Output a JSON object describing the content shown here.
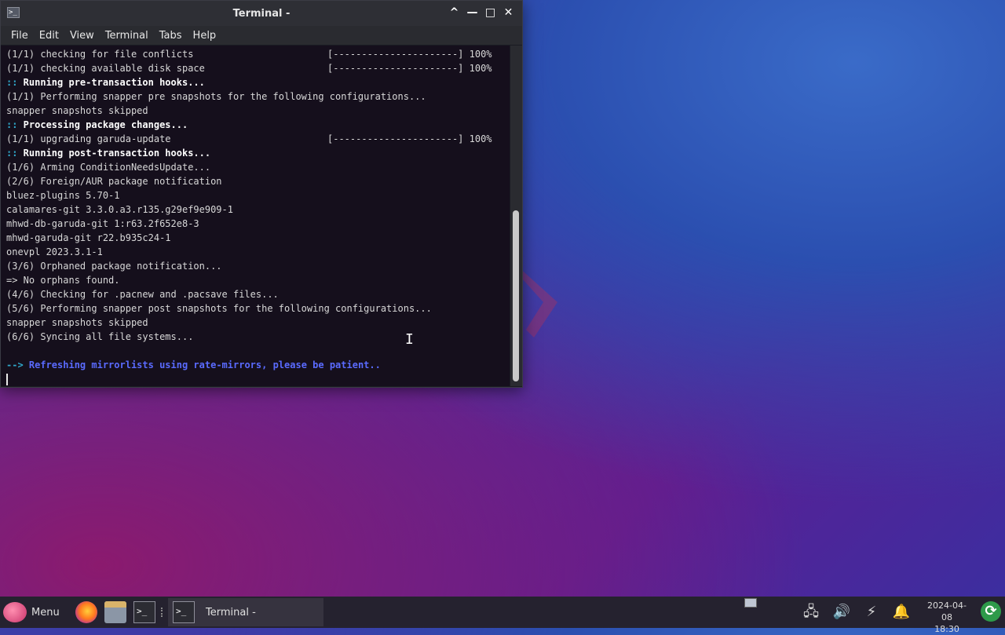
{
  "window": {
    "title": "Terminal -",
    "controls": {
      "shade": "^",
      "minimize": "—",
      "maximize": "□",
      "close": "✕"
    }
  },
  "menubar": [
    "File",
    "Edit",
    "View",
    "Terminal",
    "Tabs",
    "Help"
  ],
  "terminal": {
    "lines": [
      {
        "text": "(1/1) checking for file conflicts",
        "right": "[----------------------] 100%"
      },
      {
        "text": "(1/1) checking available disk space",
        "right": "[----------------------] 100%"
      },
      {
        "prefix": "::",
        "text": " Running pre-transaction hooks...",
        "style": "bold"
      },
      {
        "text": "(1/1) Performing snapper pre snapshots for the following configurations..."
      },
      {
        "text": "snapper snapshots skipped"
      },
      {
        "prefix": "::",
        "text": " Processing package changes...",
        "style": "bold"
      },
      {
        "text": "(1/1) upgrading garuda-update",
        "right": "[----------------------] 100%"
      },
      {
        "prefix": "::",
        "text": " Running post-transaction hooks...",
        "style": "bold"
      },
      {
        "text": "(1/6) Arming ConditionNeedsUpdate..."
      },
      {
        "text": "(2/6) Foreign/AUR package notification"
      },
      {
        "text": "bluez-plugins 5.70-1"
      },
      {
        "text": "calamares-git 3.3.0.a3.r135.g29ef9e909-1"
      },
      {
        "text": "mhwd-db-garuda-git 1:r63.2f652e8-3"
      },
      {
        "text": "mhwd-garuda-git r22.b935c24-1"
      },
      {
        "text": "onevpl 2023.3.1-1"
      },
      {
        "text": "(3/6) Orphaned package notification..."
      },
      {
        "text": "=> No orphans found."
      },
      {
        "text": "(4/6) Checking for .pacnew and .pacsave files..."
      },
      {
        "text": "(5/6) Performing snapper post snapshots for the following configurations..."
      },
      {
        "text": "snapper snapshots skipped"
      },
      {
        "text": "(6/6) Syncing all file systems..."
      },
      {
        "text": ""
      },
      {
        "prefix": "-->",
        "text": " Refreshing mirrorlists using rate-mirrors, please be patient..",
        "style": "blue"
      }
    ],
    "scroll_position": 0.95
  },
  "taskbar": {
    "menu_label": "Menu",
    "task_label": "Terminal -",
    "date": "2024-04-08",
    "time": "18:30"
  },
  "colors": {
    "prompt_cyan": "#2fa7c9",
    "mirror_blue": "#5a6bff",
    "update_green": "#2e9a4a"
  },
  "icons": [
    "terminal-icon",
    "firefox-icon",
    "files-icon",
    "network-icon",
    "volume-icon",
    "power-icon",
    "notifications-icon",
    "update-icon"
  ]
}
